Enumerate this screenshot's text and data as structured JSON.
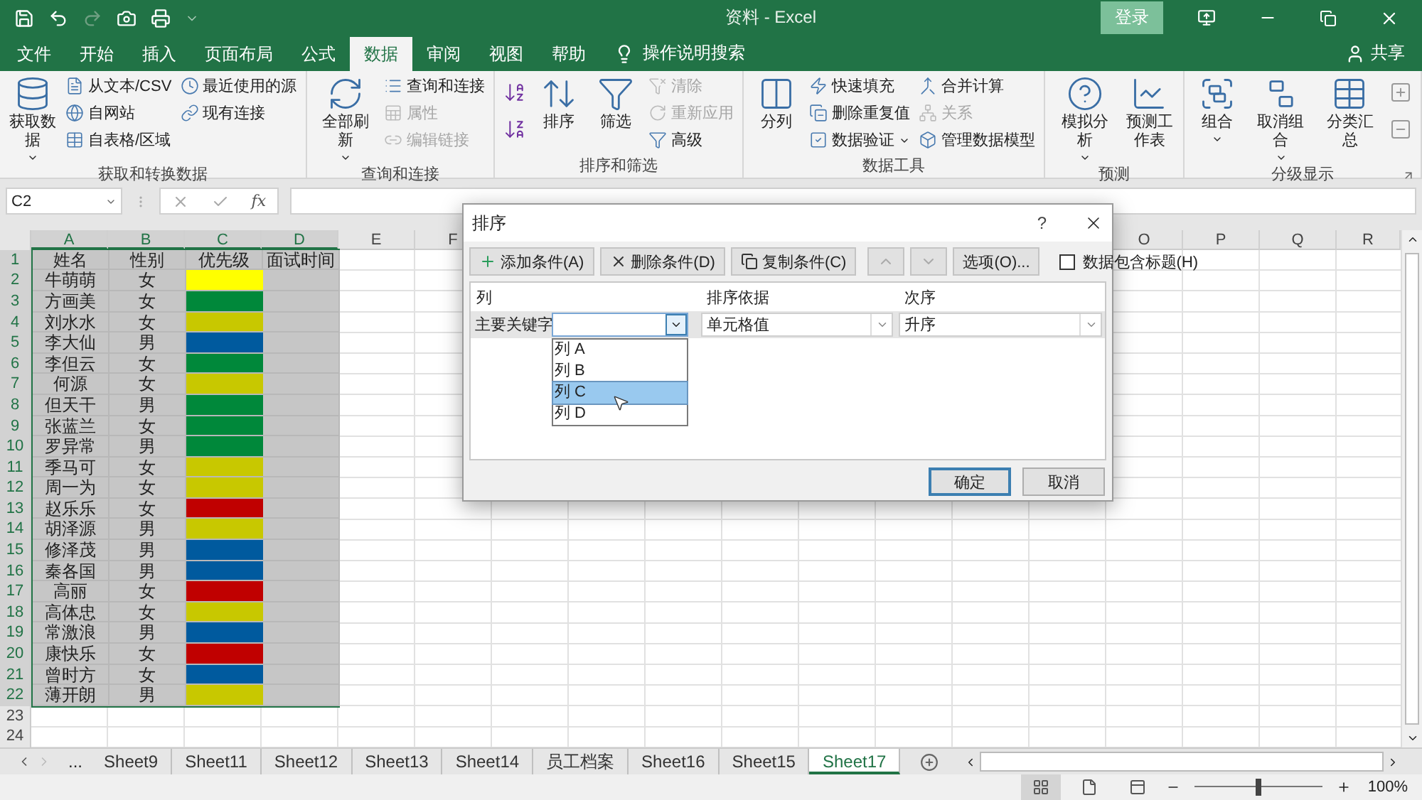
{
  "window": {
    "title": "资料 - Excel",
    "sign_in": "登录"
  },
  "ribbon_tabs": [
    {
      "label": "文件",
      "selected": false
    },
    {
      "label": "开始",
      "selected": false
    },
    {
      "label": "插入",
      "selected": false
    },
    {
      "label": "页面布局",
      "selected": false
    },
    {
      "label": "公式",
      "selected": false
    },
    {
      "label": "数据",
      "selected": true
    },
    {
      "label": "审阅",
      "selected": false
    },
    {
      "label": "视图",
      "selected": false
    },
    {
      "label": "帮助",
      "selected": false
    }
  ],
  "tell_me": "操作说明搜索",
  "share": "共享",
  "ribbon_groups": [
    {
      "label": "获取和转换数据",
      "dialog_launcher": false,
      "columns": [
        {
          "kind": "large",
          "label": "获取数据",
          "dropdown": true
        },
        {
          "kind": "stack",
          "items": [
            {
              "label": "从文本/CSV",
              "disabled": false,
              "dropdown": false
            },
            {
              "label": "自网站",
              "disabled": false,
              "dropdown": false
            },
            {
              "label": "自表格/区域",
              "disabled": false,
              "dropdown": false
            }
          ]
        },
        {
          "kind": "stack",
          "items": [
            {
              "label": "最近使用的源",
              "disabled": false,
              "dropdown": false
            },
            {
              "label": "现有连接",
              "disabled": false,
              "dropdown": false
            }
          ]
        }
      ]
    },
    {
      "label": "查询和连接",
      "dialog_launcher": false,
      "columns": [
        {
          "kind": "large",
          "label": "全部刷新",
          "dropdown": true
        },
        {
          "kind": "stack",
          "items": [
            {
              "label": "查询和连接",
              "disabled": false,
              "dropdown": false
            },
            {
              "label": "属性",
              "disabled": true,
              "dropdown": false
            },
            {
              "label": "编辑链接",
              "disabled": true,
              "dropdown": false
            }
          ]
        }
      ]
    },
    {
      "label": "排序和筛选",
      "dialog_launcher": false,
      "columns": [
        {
          "kind": "icon_stack"
        },
        {
          "kind": "large",
          "label": "排序",
          "dropdown": false
        },
        {
          "kind": "large",
          "label": "筛选",
          "dropdown": false
        },
        {
          "kind": "stack",
          "items": [
            {
              "label": "清除",
              "disabled": true,
              "dropdown": false
            },
            {
              "label": "重新应用",
              "disabled": true,
              "dropdown": false
            },
            {
              "label": "高级",
              "disabled": false,
              "dropdown": false
            }
          ]
        }
      ]
    },
    {
      "label": "数据工具",
      "dialog_launcher": false,
      "columns": [
        {
          "kind": "large",
          "label": "分列",
          "dropdown": false
        },
        {
          "kind": "stack",
          "items": [
            {
              "label": "快速填充",
              "disabled": false,
              "dropdown": false
            },
            {
              "label": "删除重复值",
              "disabled": false,
              "dropdown": false
            },
            {
              "label": "数据验证",
              "disabled": false,
              "dropdown": true
            }
          ]
        },
        {
          "kind": "stack",
          "items": [
            {
              "label": "合并计算",
              "disabled": false,
              "dropdown": false
            },
            {
              "label": "关系",
              "disabled": true,
              "dropdown": false
            },
            {
              "label": "管理数据模型",
              "disabled": false,
              "dropdown": false
            }
          ]
        }
      ]
    },
    {
      "label": "预测",
      "dialog_launcher": false,
      "columns": [
        {
          "kind": "large",
          "label": "模拟分析",
          "dropdown": true
        },
        {
          "kind": "large",
          "label": "预测工作表",
          "dropdown": false
        }
      ]
    },
    {
      "label": "分级显示",
      "dialog_launcher": true,
      "columns": [
        {
          "kind": "large",
          "label": "组合",
          "dropdown": true
        },
        {
          "kind": "large",
          "label": "取消组合",
          "dropdown": true
        },
        {
          "kind": "large",
          "label": "分类汇总",
          "dropdown": false
        },
        {
          "kind": "icon_stack"
        }
      ]
    }
  ],
  "formula_bar": {
    "name_box": "C2",
    "function_label": "fx"
  },
  "sheet": {
    "columns": [
      {
        "label": "A",
        "selected": true
      },
      {
        "label": "B",
        "selected": true
      },
      {
        "label": "C",
        "selected": true
      },
      {
        "label": "D",
        "selected": true
      },
      {
        "label": "E",
        "selected": false
      },
      {
        "label": "F",
        "selected": false
      },
      {
        "label": "O",
        "selected": false
      },
      {
        "label": "P",
        "selected": false
      },
      {
        "label": "Q",
        "selected": false
      },
      {
        "label": "R",
        "selected": false
      }
    ],
    "rows": [
      {
        "kind": "header",
        "number": "1",
        "selected": true,
        "cells": [
          "姓名",
          "性别",
          "优先级",
          "面试时间"
        ]
      },
      {
        "kind": "data",
        "number": "2",
        "selected": true,
        "name": "牛萌萌",
        "gender": "女",
        "color": "#ffff00"
      },
      {
        "kind": "data",
        "number": "3",
        "selected": true,
        "name": "方画美",
        "gender": "女",
        "color": "#00883a"
      },
      {
        "kind": "data",
        "number": "4",
        "selected": true,
        "name": "刘水水",
        "gender": "女",
        "color": "#c8c800"
      },
      {
        "kind": "data",
        "number": "5",
        "selected": true,
        "name": "李大仙",
        "gender": "男",
        "color": "#005a9e"
      },
      {
        "kind": "data",
        "number": "6",
        "selected": true,
        "name": "李但云",
        "gender": "女",
        "color": "#00883a"
      },
      {
        "kind": "data",
        "number": "7",
        "selected": true,
        "name": "何源",
        "gender": "女",
        "color": "#c8c800"
      },
      {
        "kind": "data",
        "number": "8",
        "selected": true,
        "name": "但天干",
        "gender": "男",
        "color": "#00883a"
      },
      {
        "kind": "data",
        "number": "9",
        "selected": true,
        "name": "张蓝兰",
        "gender": "女",
        "color": "#00883a"
      },
      {
        "kind": "data",
        "number": "10",
        "selected": true,
        "name": "罗异常",
        "gender": "男",
        "color": "#00883a"
      },
      {
        "kind": "data",
        "number": "11",
        "selected": true,
        "name": "季马可",
        "gender": "女",
        "color": "#c8c800"
      },
      {
        "kind": "data",
        "number": "12",
        "selected": true,
        "name": "周一为",
        "gender": "女",
        "color": "#c8c800"
      },
      {
        "kind": "data",
        "number": "13",
        "selected": true,
        "name": "赵乐乐",
        "gender": "女",
        "color": "#c00000"
      },
      {
        "kind": "data",
        "number": "14",
        "selected": true,
        "name": "胡泽源",
        "gender": "男",
        "color": "#c8c800"
      },
      {
        "kind": "data",
        "number": "15",
        "selected": true,
        "name": "修泽茂",
        "gender": "男",
        "color": "#005a9e"
      },
      {
        "kind": "data",
        "number": "16",
        "selected": true,
        "name": "秦各国",
        "gender": "男",
        "color": "#005a9e"
      },
      {
        "kind": "data",
        "number": "17",
        "selected": true,
        "name": "高丽",
        "gender": "女",
        "color": "#c00000"
      },
      {
        "kind": "data",
        "number": "18",
        "selected": true,
        "name": "高体忠",
        "gender": "女",
        "color": "#c8c800"
      },
      {
        "kind": "data",
        "number": "19",
        "selected": true,
        "name": "常激浪",
        "gender": "男",
        "color": "#005a9e"
      },
      {
        "kind": "data",
        "number": "20",
        "selected": true,
        "name": "康快乐",
        "gender": "女",
        "color": "#c00000"
      },
      {
        "kind": "data",
        "number": "21",
        "selected": true,
        "name": "曾时方",
        "gender": "女",
        "color": "#005a9e"
      },
      {
        "kind": "data",
        "number": "22",
        "selected": true,
        "name": "薄开朗",
        "gender": "男",
        "color": "#c8c800"
      },
      {
        "kind": "empty",
        "number": "23",
        "selected": false
      },
      {
        "kind": "empty",
        "number": "24",
        "selected": false
      }
    ]
  },
  "sort_dialog": {
    "title": "排序",
    "help": "?",
    "toolbar": [
      {
        "label": "添加条件(A)"
      },
      {
        "label": "删除条件(D)"
      },
      {
        "label": "复制条件(C)"
      }
    ],
    "options": "选项(O)...",
    "has_headers": {
      "label": "数据包含标题(H)",
      "checked": false
    },
    "headers": [
      "列",
      "排序依据",
      "次序"
    ],
    "level": {
      "label": "主要关键字",
      "sort_on": "单元格值",
      "order": "升序"
    },
    "column_options": [
      {
        "label": "列 A",
        "selected": false
      },
      {
        "label": "列 B",
        "selected": false
      },
      {
        "label": "列 C",
        "selected": true
      },
      {
        "label": "列 D",
        "selected": false
      }
    ],
    "buttons": [
      {
        "label": "确定",
        "default": true
      },
      {
        "label": "取消",
        "default": false
      }
    ]
  },
  "sheet_tabs": {
    "more": "...",
    "tabs": [
      {
        "label": "Sheet9",
        "selected": false
      },
      {
        "label": "Sheet11",
        "selected": false
      },
      {
        "label": "Sheet12",
        "selected": false
      },
      {
        "label": "Sheet13",
        "selected": false
      },
      {
        "label": "Sheet14",
        "selected": false
      },
      {
        "label": "员工档案",
        "selected": false
      },
      {
        "label": "Sheet16",
        "selected": false
      },
      {
        "label": "Sheet15",
        "selected": false
      },
      {
        "label": "Sheet17",
        "selected": true
      }
    ]
  },
  "status_bar": {
    "views": [
      {
        "selected": true
      },
      {
        "selected": false
      },
      {
        "selected": false
      }
    ],
    "zoom": {
      "level": 0.5,
      "reading": "100%"
    }
  }
}
